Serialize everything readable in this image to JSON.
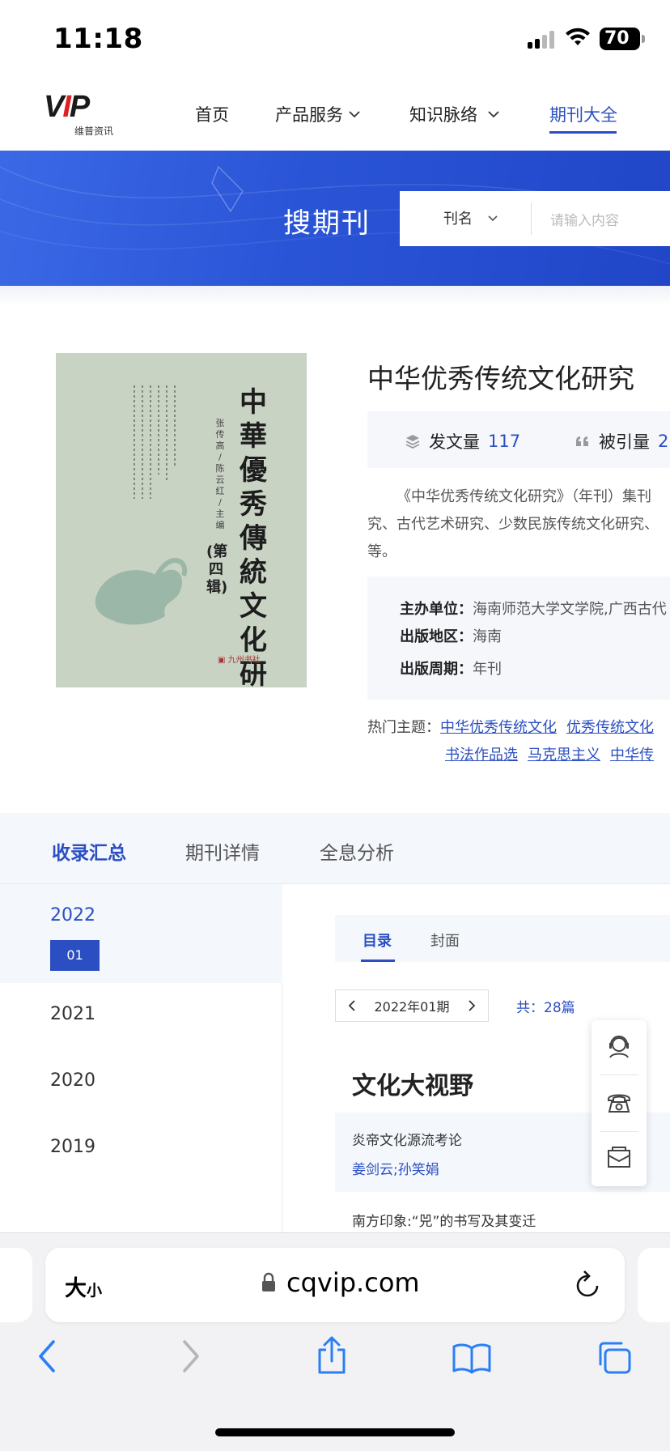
{
  "status_bar": {
    "time": "11:18",
    "battery": "70"
  },
  "site": {
    "logo_text": "VIP",
    "logo_sub": "维普资讯",
    "nav": [
      {
        "label": "首页"
      },
      {
        "label": "产品服务"
      },
      {
        "label": "知识脉络"
      },
      {
        "label": "期刊大全",
        "active": true
      }
    ]
  },
  "banner": {
    "title": "搜期刊",
    "search_field": "刊名",
    "search_placeholder": "请输入内容"
  },
  "journal": {
    "cover_title": "中華優秀傳統文化研究",
    "cover_volume": "(第四辑)",
    "cover_editors": "张传高 / 陈云红 / 主编",
    "title": "中华优秀传统文化研究",
    "stats": {
      "articles_label": "发文量",
      "articles_value": "117",
      "citations_label": "被引量",
      "citations_value": "2"
    },
    "description_lines": [
      "《中华优秀传统文化研究》（年刊）集刊",
      "究、古代艺术研究、少数民族传统文化研究、",
      "等。"
    ],
    "meta": [
      {
        "key": "主办单位：",
        "value": "海南师范大学文学院,广西古代"
      },
      {
        "key": "出版地区：",
        "value": "海南"
      },
      {
        "key": "出版周期：",
        "value": "年刊"
      }
    ],
    "hot_topics_label": "热门主题：",
    "hot_topics_row1": [
      "中华优秀传统文化",
      "优秀传统文化"
    ],
    "hot_topics_row2": [
      "书法作品选",
      "马克思主义",
      "中华传"
    ]
  },
  "tabs": [
    {
      "label": "收录汇总",
      "active": true
    },
    {
      "label": "期刊详情"
    },
    {
      "label": "全息分析"
    }
  ],
  "years": [
    {
      "year": "2022",
      "active": true,
      "issue": "01"
    },
    {
      "year": "2021"
    },
    {
      "year": "2020"
    },
    {
      "year": "2019"
    }
  ],
  "content": {
    "subtabs": [
      {
        "label": "目录",
        "active": true
      },
      {
        "label": "封面"
      }
    ],
    "pager_label": "2022年01期",
    "total": "共：28篇",
    "section_heading": "文化大视野",
    "articles": [
      {
        "title": "炎帝文化源流考论",
        "authors": "姜剑云;孙笑娟"
      },
      {
        "title": "南方印象:“兕”的书写及其变迁"
      }
    ]
  },
  "safari": {
    "text_size_label": "大",
    "text_size_small": "小",
    "url": "cqvip.com"
  },
  "colors": {
    "brand_blue": "#2b4fc2",
    "banner_blue": "#2a54d6"
  }
}
